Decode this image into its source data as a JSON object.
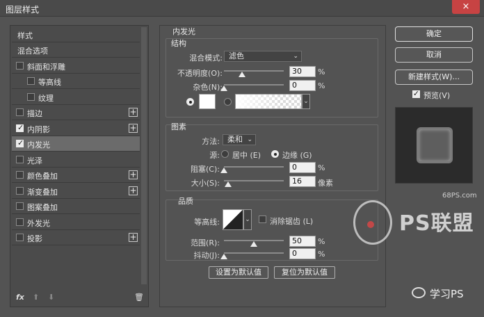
{
  "window": {
    "title": "图层样式",
    "close": "×"
  },
  "left": {
    "header": "样式",
    "items": [
      {
        "label": "混合选项",
        "checkbox": false,
        "checked": false,
        "indent": 0,
        "plus": false
      },
      {
        "label": "斜面和浮雕",
        "checkbox": true,
        "checked": false,
        "indent": 0,
        "plus": false
      },
      {
        "label": "等高线",
        "checkbox": true,
        "checked": false,
        "indent": 1,
        "plus": false
      },
      {
        "label": "纹理",
        "checkbox": true,
        "checked": false,
        "indent": 1,
        "plus": false
      },
      {
        "label": "描边",
        "checkbox": true,
        "checked": false,
        "indent": 0,
        "plus": true
      },
      {
        "label": "内阴影",
        "checkbox": true,
        "checked": true,
        "indent": 0,
        "plus": true
      },
      {
        "label": "内发光",
        "checkbox": true,
        "checked": true,
        "indent": 0,
        "plus": false
      },
      {
        "label": "光泽",
        "checkbox": true,
        "checked": false,
        "indent": 0,
        "plus": false
      },
      {
        "label": "颜色叠加",
        "checkbox": true,
        "checked": false,
        "indent": 0,
        "plus": true
      },
      {
        "label": "渐变叠加",
        "checkbox": true,
        "checked": false,
        "indent": 0,
        "plus": true
      },
      {
        "label": "图案叠加",
        "checkbox": true,
        "checked": false,
        "indent": 0,
        "plus": false
      },
      {
        "label": "外发光",
        "checkbox": true,
        "checked": false,
        "indent": 0,
        "plus": false
      },
      {
        "label": "投影",
        "checkbox": true,
        "checked": false,
        "indent": 0,
        "plus": true
      }
    ],
    "footer": {
      "fx": "fx",
      "up": "⬆",
      "down": "⬇",
      "trash": "🗑"
    }
  },
  "panel": {
    "title": "内发光",
    "structure": {
      "header": "结构",
      "blend_label": "混合模式:",
      "blend_value": "滤色",
      "opacity_label": "不透明度(O):",
      "opacity_value": "30",
      "opacity_unit": "%",
      "opacity_level": 0.3,
      "noise_label": "杂色(N):",
      "noise_value": "0",
      "noise_unit": "%",
      "noise_level": 0.0,
      "color_swatch": "#ffffff"
    },
    "elements": {
      "header": "图素",
      "method_label": "方法:",
      "method_value": "柔和",
      "source_label": "源:",
      "source_center": "居中 (E)",
      "source_edge": "边缘 (G)",
      "choke_label": "阻塞(C):",
      "choke_value": "0",
      "choke_unit": "%",
      "choke_level": 0.0,
      "size_label": "大小(S):",
      "size_value": "16",
      "size_unit": "像素",
      "size_level": 0.064
    },
    "quality": {
      "header": "品质",
      "contour_label": "等高线:",
      "antialias_label": "消除锯齿 (L)",
      "range_label": "范围(R):",
      "range_value": "50",
      "range_unit": "%",
      "range_level": 0.5,
      "jitter_label": "抖动(J):",
      "jitter_value": "0",
      "jitter_unit": "%",
      "jitter_level": 0.0
    },
    "make_default": "设置为默认值",
    "reset_default": "复位为默认值"
  },
  "right": {
    "ok": "确定",
    "cancel": "取消",
    "new_style": "新建样式(W)...",
    "preview_label": "预览(V)"
  },
  "watermark": {
    "site": "68PS.com",
    "brand": "PS联盟",
    "wechat": "学习PS"
  }
}
